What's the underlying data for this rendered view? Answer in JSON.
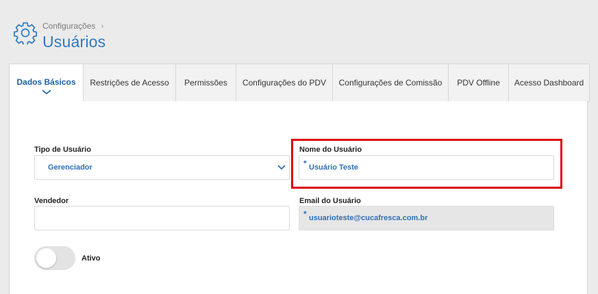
{
  "header": {
    "breadcrumb": "Configurações",
    "breadcrumb_separator": "›",
    "title": "Usuários",
    "icon": "gear-icon"
  },
  "tabs": [
    {
      "label": "Dados Básicos",
      "active": true
    },
    {
      "label": "Restrições de Acesso",
      "active": false
    },
    {
      "label": "Permissões",
      "active": false
    },
    {
      "label": "Configurações do PDV",
      "active": false
    },
    {
      "label": "Configurações de Comissão",
      "active": false
    },
    {
      "label": "PDV Offline",
      "active": false
    },
    {
      "label": "Acesso Dashboard",
      "active": false
    }
  ],
  "form": {
    "tipo_usuario": {
      "label": "Tipo de Usuário",
      "value": "Gerenciador"
    },
    "nome_usuario": {
      "label": "Nome do Usuário",
      "value": "Usuário Teste",
      "required_mark": "*"
    },
    "vendedor": {
      "label": "Vendedor",
      "value": ""
    },
    "email_usuario": {
      "label": "Email do Usuário",
      "value": "usuarioteste@cucafresca.com.br",
      "required_mark": "*"
    },
    "ativo": {
      "label": "Ativo",
      "on": false
    }
  },
  "colors": {
    "accent": "#2f7ac1",
    "highlight": "#d9000d",
    "value_text": "#2f6fb6"
  }
}
